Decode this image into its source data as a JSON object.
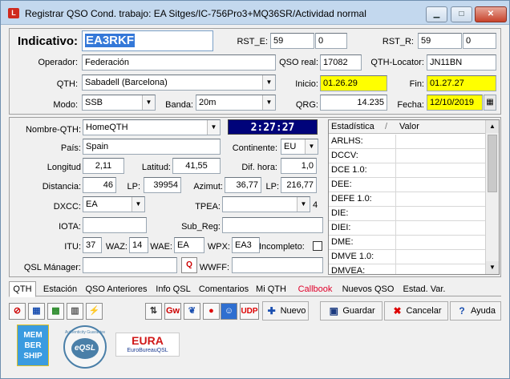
{
  "window": {
    "title": "Registrar QSO  Cond. trabajo: EA Sitges/IC-756Pro3+MQ36SR/Actividad normal",
    "minimize_icon": "minimize-icon",
    "maximize_icon": "maximize-icon",
    "close_icon": "close-icon"
  },
  "top": {
    "indicativo_label": "Indicativo:",
    "indicativo": "EA3RKF",
    "rst_e_label": "RST_E:",
    "rst_e_1": "59",
    "rst_e_2": "0",
    "rst_r_label": "RST_R:",
    "rst_r_1": "59",
    "rst_r_2": "0",
    "operador_label": "Operador:",
    "operador": "Federación",
    "qso_real_label": "QSO real:",
    "qso_real": "17082",
    "qth_locator_label": "QTH-Locator:",
    "qth_locator": "JN11BN",
    "qth_label": "QTH:",
    "qth": "Sabadell (Barcelona)",
    "inicio_label": "Inicio:",
    "inicio": "01.26.29",
    "fin_label": "Fin:",
    "fin": "01.27.27",
    "modo_label": "Modo:",
    "modo": "SSB",
    "banda_label": "Banda:",
    "banda": "20m",
    "qrg_label": "QRG:",
    "qrg": "14.235",
    "fecha_label": "Fecha:",
    "fecha": "12/10/2019"
  },
  "detail": {
    "nombre_qth_label": "Nombre-QTH:",
    "nombre_qth": "HomeQTH",
    "clock": "2:27:27",
    "pais_label": "País:",
    "pais": "Spain",
    "continente_label": "Continente:",
    "continente": "EU",
    "longitud_label": "Longitud",
    "longitud": "2,11",
    "latitud_label": "Latitud:",
    "latitud": "41,55",
    "dif_hora_label": "Dif. hora:",
    "dif_hora": "1,0",
    "distancia_label": "Distancia:",
    "distancia": "46",
    "lp1_label": "LP:",
    "lp1": "39954",
    "azimut_label": "Azimut:",
    "azimut": "36,77",
    "lp2_label": "LP:",
    "lp2": "216,77",
    "dxcc_label": "DXCC:",
    "dxcc": "EA",
    "tpea_label": "TPEA:",
    "tpea": "",
    "tpea_count": "4",
    "iota_label": "IOTA:",
    "iota": "",
    "sub_reg_label": "Sub_Reg:",
    "sub_reg": "",
    "itu_label": "ITU:",
    "itu": "37",
    "waz_label": "WAZ:",
    "waz": "14",
    "wae_label": "WAE:",
    "wae": "EA",
    "wpx_label": "WPX:",
    "wpx": "EA3",
    "incompleto_label": "Incompleto:",
    "qsl_manager_label": "QSL Mánager:",
    "qsl_manager": "",
    "wwff_label": "WWFF:",
    "wwff": ""
  },
  "stats": {
    "header_col1": "Estadística",
    "header_sort": "/",
    "header_col2": "Valor",
    "rows": [
      "ARLHS:",
      "DCCV:",
      "DCE 1.0:",
      "DEE:",
      "DEFE 1.0:",
      "DIE:",
      "DIEI:",
      "DME:",
      "DMVE 1.0:",
      "DMVEA:"
    ]
  },
  "tabs": [
    "QTH",
    "Estación",
    "QSO Anteriores",
    "Info QSL",
    "Comentarios",
    "Mi QTH",
    "Callbook",
    "Nuevos QSO",
    "Estad. Var."
  ],
  "toolbar": {
    "udp": "UDP",
    "nuevo": "Nuevo",
    "guardar": "Guardar",
    "cancelar": "Cancelar",
    "ayuda": "Ayuda",
    "gw": "Gw"
  },
  "logos": {
    "membership_1": "MEM",
    "membership_2": "BER",
    "membership_3": "SHIP",
    "eqsl": "eQSL",
    "eqsl_ring": "Authenticity Guaranteed",
    "eura": "EURA",
    "eura_sub": "EuroBureauQSL"
  },
  "colors": {
    "highlight": "#ffff00",
    "clock_bg": "#00037a",
    "callbook": "#e0002a"
  }
}
